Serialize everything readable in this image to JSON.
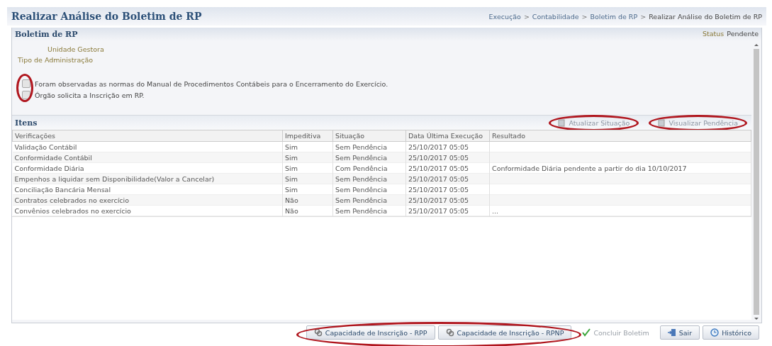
{
  "header": {
    "title": "Realizar Análise do Boletim de RP",
    "breadcrumb": [
      "Execução",
      "Contabilidade",
      "Boletim de RP",
      "Realizar Análise do Boletim de RP"
    ],
    "separator": ">"
  },
  "section": {
    "title": "Boletim de RP",
    "status_label": "Status",
    "status_value": "Pendente"
  },
  "fields": [
    {
      "label": "Unidade Gestora",
      "indented": true
    },
    {
      "label": "Tipo de Administração",
      "indented": false
    }
  ],
  "checkboxes_highlighted": true,
  "checkboxes": [
    {
      "label": "Foram observadas as normas do Manual de Procedimentos Contábeis para o Encerramento do Exercício.",
      "checked": false,
      "disabled": true
    },
    {
      "label": "Órgão solicita a Inscrição em RP.",
      "checked": false,
      "disabled": true
    }
  ],
  "items": {
    "title": "Itens",
    "actions": [
      {
        "label": "Atualizar Situação",
        "disabled": true,
        "highlighted": true
      },
      {
        "label": "Visualizar Pendência",
        "disabled": true,
        "highlighted": true
      }
    ],
    "columns": [
      "Verificações",
      "Impeditiva",
      "Situação",
      "Data Última Execução",
      "Resultado"
    ],
    "rows": [
      [
        "Validação Contábil",
        "Sim",
        "Sem Pendência",
        "25/10/2017 05:05",
        ""
      ],
      [
        "Conformidade Contábil",
        "Sim",
        "Sem Pendência",
        "25/10/2017 05:05",
        ""
      ],
      [
        "Conformidade Diária",
        "Sim",
        "Com Pendência",
        "25/10/2017 05:05",
        "Conformidade Diária pendente a partir do dia 10/10/2017"
      ],
      [
        "Empenhos a liquidar sem Disponibilidade(Valor a Cancelar)",
        "Sim",
        "Sem Pendência",
        "25/10/2017 05:05",
        ""
      ],
      [
        "Conciliação Bancária Mensal",
        "Sim",
        "Sem Pendência",
        "25/10/2017 05:05",
        ""
      ],
      [
        "Contratos celebrados no exercício",
        "Não",
        "Sem Pendência",
        "25/10/2017 05:05",
        ""
      ],
      [
        "Convênios celebrados no exercício",
        "Não",
        "Sem Pendência",
        "25/10/2017 05:05",
        "..."
      ]
    ]
  },
  "buttons_highlighted": true,
  "buttons": [
    {
      "label": "Capacidade de Inscrição - RPP",
      "kind": "link",
      "disabled": false
    },
    {
      "label": "Capacidade de Inscrição - RPNP",
      "kind": "link",
      "disabled": false
    },
    {
      "label": "Concluir Boletim",
      "kind": "check",
      "disabled": true
    },
    {
      "label": "Sair",
      "kind": "exit",
      "disabled": false
    },
    {
      "label": "Histórico",
      "kind": "history",
      "disabled": false
    }
  ]
}
